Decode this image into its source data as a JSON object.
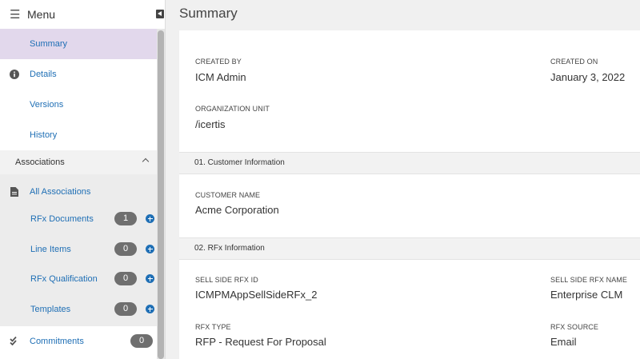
{
  "sidebar": {
    "menu_label": "Menu",
    "items": {
      "summary": "Summary",
      "details": "Details",
      "versions": "Versions",
      "history": "History"
    },
    "associations": {
      "header": "Associations",
      "all": "All Associations",
      "items": [
        {
          "label": "RFx Documents",
          "count": "1"
        },
        {
          "label": "Line Items",
          "count": "0"
        },
        {
          "label": "RFx Qualification",
          "count": "0"
        },
        {
          "label": "Templates",
          "count": "0"
        }
      ]
    },
    "commitments": {
      "label": "Commitments",
      "count": "0"
    }
  },
  "main": {
    "title": "Summary",
    "created_by": {
      "label": "CREATED BY",
      "value": "ICM Admin"
    },
    "created_on": {
      "label": "CREATED ON",
      "value": "January 3, 2022"
    },
    "org_unit": {
      "label": "ORGANIZATION UNIT",
      "value": "/icertis"
    },
    "section1": "01. Customer Information",
    "customer_name": {
      "label": "CUSTOMER NAME",
      "value": "Acme Corporation"
    },
    "section2": "02. RFx Information",
    "sell_side_rfx_id": {
      "label": "SELL SIDE RFX ID",
      "value": "ICMPMAppSellSideRFx_2"
    },
    "sell_side_rfx_name": {
      "label": "SELL SIDE RFX NAME",
      "value": "Enterprise CLM"
    },
    "rfx_type": {
      "label": "RFX TYPE",
      "value": "RFP - Request For Proposal"
    },
    "rfx_source": {
      "label": "RFX SOURCE",
      "value": "Email"
    }
  },
  "colors": {
    "accent": "#1f6fb5",
    "selected_bg": "#e2d8ec",
    "badge": "#6f6f6f"
  }
}
